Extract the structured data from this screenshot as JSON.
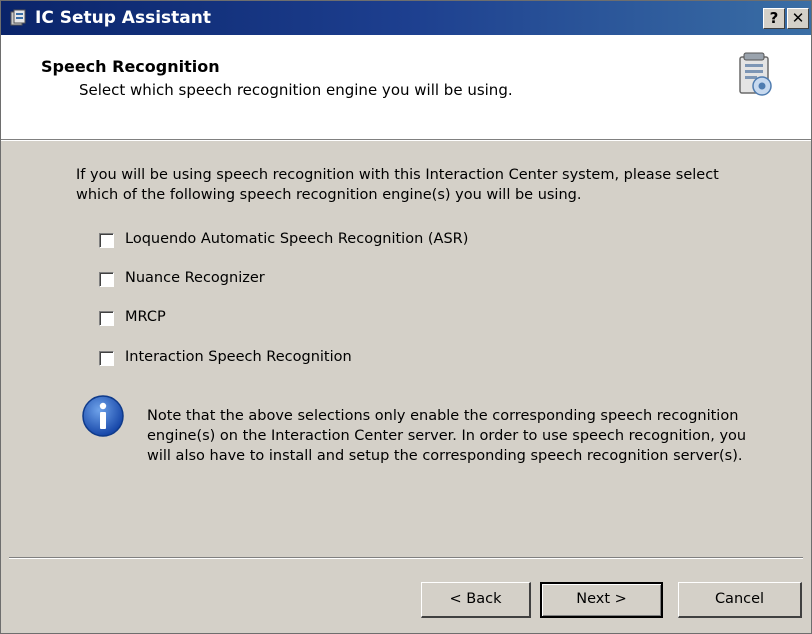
{
  "window": {
    "title": "IC Setup Assistant",
    "help_glyph": "?",
    "close_glyph": "✕"
  },
  "header": {
    "title": "Speech Recognition",
    "subtitle": "Select which speech recognition engine you will be using.",
    "icon": "setup-wizard-icon"
  },
  "intro": "If you will be using speech recognition with this Interaction Center system, please select which of the following speech recognition engine(s) you will be using.",
  "options": [
    {
      "label": "Loquendo Automatic Speech Recognition (ASR)",
      "checked": false
    },
    {
      "label": "Nuance Recognizer",
      "checked": false
    },
    {
      "label": "MRCP",
      "checked": false
    },
    {
      "label": "Interaction Speech Recognition",
      "checked": false
    }
  ],
  "note": "Note that the above selections only enable the corresponding speech recognition engine(s) on the Interaction Center server. In order to use speech recognition, you will also have to install and setup the corresponding speech recognition server(s).",
  "buttons": {
    "back": "< Back",
    "next": "Next >",
    "cancel": "Cancel"
  },
  "colors": {
    "titlebar_start": "#0a246a",
    "titlebar_end": "#3a6ea5",
    "dialog_bg": "#d4d0c8",
    "info_icon": "#1f5fbf"
  }
}
